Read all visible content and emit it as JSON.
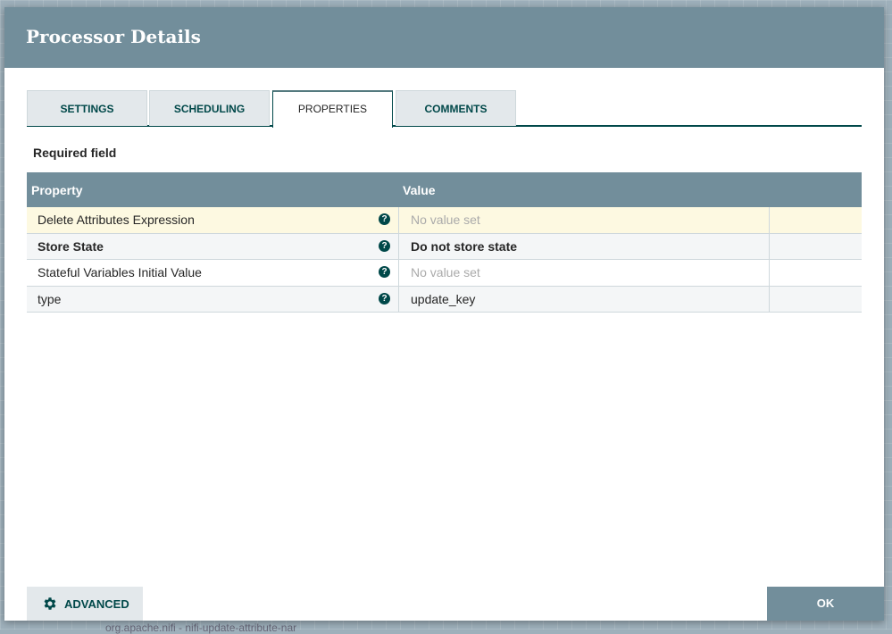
{
  "background_text": "org.apache.nifi - nifi-update-attribute-nar",
  "dialog": {
    "title": "Processor Details"
  },
  "tabs": [
    {
      "label": "SETTINGS"
    },
    {
      "label": "SCHEDULING"
    },
    {
      "label": "PROPERTIES",
      "active": true
    },
    {
      "label": "COMMENTS"
    }
  ],
  "required_field": "Required field",
  "table": {
    "headers": {
      "property": "Property",
      "value": "Value"
    },
    "rows": [
      {
        "property": "Delete Attributes Expression",
        "value": "No value set",
        "placeholder": true,
        "highlighted": true
      },
      {
        "property": "Store State",
        "value": "Do not store state",
        "required": true
      },
      {
        "property": "Stateful Variables Initial Value",
        "value": "No value set",
        "placeholder": true
      },
      {
        "property": "type",
        "value": "update_key"
      }
    ],
    "help_icon": "?"
  },
  "buttons": {
    "advanced": "ADVANCED",
    "ok": "OK"
  },
  "colors": {
    "header": "#728e9b",
    "accent": "#004849",
    "highlight_row": "#fdf9e1",
    "alt_row": "#f4f6f7"
  }
}
